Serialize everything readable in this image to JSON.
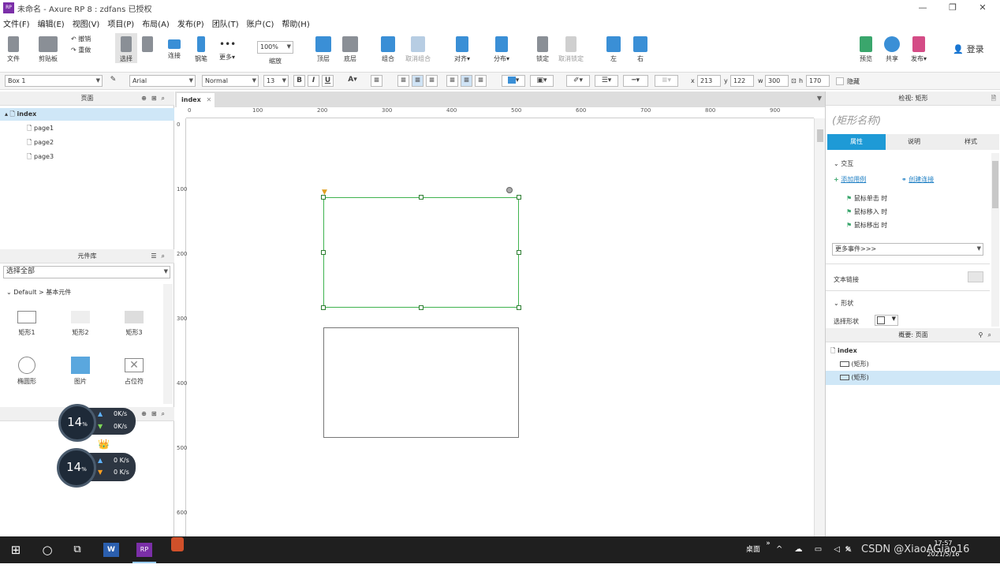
{
  "window": {
    "title": "未命名 - Axure RP 8 : zdfans 已授权",
    "app_icon": "RP"
  },
  "menu": [
    "文件(F)",
    "编辑(E)",
    "视图(V)",
    "项目(P)",
    "布局(A)",
    "发布(P)",
    "团队(T)",
    "账户(C)",
    "帮助(H)"
  ],
  "toolbar": {
    "file": "文件",
    "clipboard": "剪贴板",
    "undo": "撤销",
    "redo": "重做",
    "select": "选择",
    "connect": "连接",
    "pen": "钢笔",
    "more": "更多▾",
    "zoom_value": "100%",
    "zoom_label": "缩放",
    "top": "顶层",
    "bottom": "底层",
    "group": "组合",
    "ungroup": "取消组合",
    "align": "对齐▾",
    "distribute": "分布▾",
    "lock": "锁定",
    "unlock": "取消锁定",
    "left": "左",
    "right": "右",
    "preview": "预览",
    "share": "共享",
    "publish": "发布▾",
    "login": "登录"
  },
  "format": {
    "shape_name": "Box 1",
    "font": "Arial",
    "style": "Normal",
    "size": "13",
    "x_label": "x",
    "x": "213",
    "y_label": "y",
    "y": "122",
    "w_label": "w",
    "w": "300",
    "h_label": "h",
    "h": "170",
    "hide": "隐藏"
  },
  "pages_panel": {
    "title": "页面",
    "items": [
      {
        "label": "index"
      },
      {
        "label": "page1"
      },
      {
        "label": "page2"
      },
      {
        "label": "page3"
      }
    ]
  },
  "library": {
    "title": "元件库",
    "select_all": "选择全部",
    "group": "Default > 基本元件",
    "widgets": [
      {
        "label": "矩形1"
      },
      {
        "label": "矩形2"
      },
      {
        "label": "矩形3"
      },
      {
        "label": "椭圆形"
      },
      {
        "label": "图片"
      },
      {
        "label": "占位符"
      }
    ]
  },
  "speed_widget": {
    "pct1": "14",
    "unit": "%",
    "up1": "0K/s",
    "down1": "0K/s",
    "pct2": "14",
    "up2": "0 K/s",
    "down2": "0 K/s"
  },
  "canvas": {
    "tab": "index",
    "hruler": [
      "0",
      "100",
      "200",
      "300",
      "400",
      "500",
      "600",
      "700",
      "800",
      "900"
    ],
    "vruler": [
      "0",
      "100",
      "200",
      "300",
      "400",
      "500",
      "600"
    ]
  },
  "inspector": {
    "header": "检视: 矩形",
    "name_placeholder": "(矩形名称)",
    "tabs": [
      "属性",
      "说明",
      "样式"
    ],
    "interaction": "交互",
    "add_case": "添加用例",
    "create_link": "创建连接",
    "events": [
      "鼠标单击 时",
      "鼠标移入 时",
      "鼠标移出 时"
    ],
    "more_events": "更多事件>>>",
    "text_link": "文本链接",
    "shape_section": "形状",
    "select_shape": "选择形状"
  },
  "outline": {
    "header": "概要: 页面",
    "root": "index",
    "items": [
      "(矩形)",
      "(矩形)"
    ]
  },
  "taskbar": {
    "desktop": "桌面",
    "time": "17:57",
    "date": "2021/5/16",
    "watermark": "CSDN @XiaoAGiao16",
    "pinned": [
      "W",
      "RP"
    ]
  },
  "colors": {
    "accent": "#1e9ad6",
    "selection": "#3fb34f",
    "handle": "#2e7d32"
  }
}
